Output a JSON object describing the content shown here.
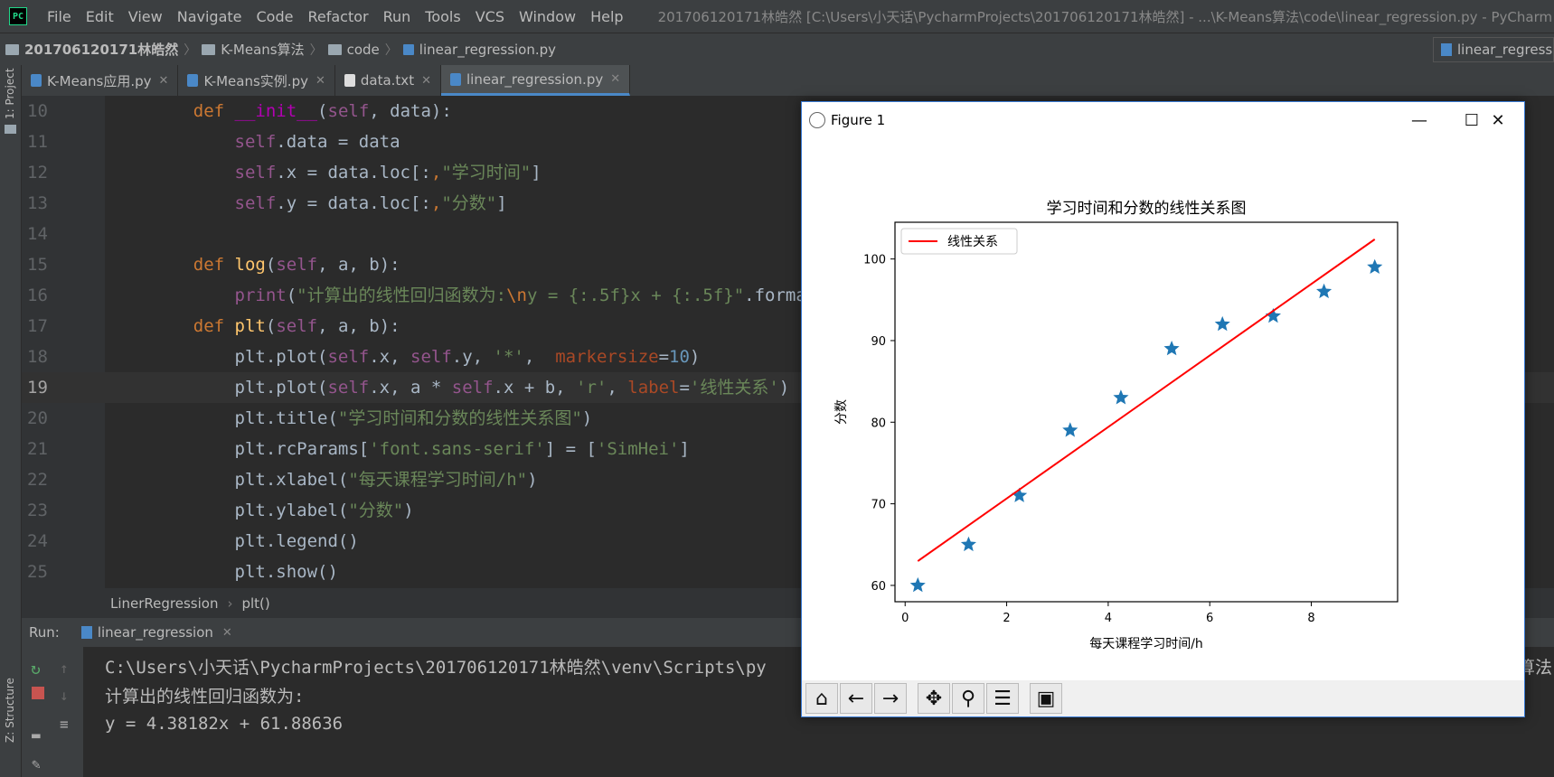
{
  "menubar": {
    "app_icon": "PC",
    "items": [
      "File",
      "Edit",
      "View",
      "Navigate",
      "Code",
      "Refactor",
      "Run",
      "Tools",
      "VCS",
      "Window",
      "Help"
    ],
    "window_title": "201706120171林皓然 [C:\\Users\\小天话\\PycharmProjects\\201706120171林皓然] - ...\\K-Means算法\\code\\linear_regression.py - PyCharm"
  },
  "breadcrumbs": [
    "201706120171林皓然",
    "K-Means算法",
    "code",
    "linear_regression.py"
  ],
  "run_config": "linear_regress",
  "left_tool": {
    "project": "1: Project",
    "structure": "Z: Structure"
  },
  "tabs": [
    {
      "label": "K-Means应用.py",
      "active": false
    },
    {
      "label": "K-Means实例.py",
      "active": false
    },
    {
      "label": "data.txt",
      "active": false
    },
    {
      "label": "linear_regression.py",
      "active": true
    }
  ],
  "editor": {
    "line_numbers": [
      "10",
      "11",
      "12",
      "13",
      "14",
      "15",
      "16",
      "17",
      "18",
      "19",
      "20",
      "21",
      "22",
      "23",
      "24",
      "25"
    ],
    "current_line": "19"
  },
  "status_crumbs": [
    "LinerRegression",
    "plt()"
  ],
  "run": {
    "label": "Run:",
    "tab": "linear_regression",
    "output": [
      "C:\\Users\\小天话\\PycharmProjects\\201706120171林皓然\\venv\\Scripts\\py",
      "计算出的线性回归函数为:",
      "y = 4.38182x + 61.88636"
    ],
    "overflow_text": "算法"
  },
  "figure": {
    "title": "Figure 1",
    "controls": {
      "minimize": "—",
      "maximize": "☐",
      "close": "✕"
    }
  },
  "chart_data": {
    "type": "scatter",
    "title": "学习时间和分数的线性关系图",
    "xlabel": "每天课程学习时间/h",
    "ylabel": "分数",
    "xlim": [
      -0.2,
      9.7
    ],
    "ylim": [
      58,
      104.5
    ],
    "xticks": [
      0,
      2,
      4,
      6,
      8
    ],
    "yticks": [
      60,
      70,
      80,
      90,
      100
    ],
    "series": [
      {
        "kind": "scatter",
        "marker": "star",
        "color": "#1f77b4",
        "x": [
          0.25,
          1.25,
          2.25,
          3.25,
          4.25,
          5.25,
          6.25,
          7.25,
          8.25,
          9.25
        ],
        "y": [
          60,
          65,
          71,
          79,
          83,
          89,
          92,
          93,
          96,
          99
        ]
      },
      {
        "kind": "line",
        "name": "线性关系",
        "color": "#ff0000",
        "x": [
          0.25,
          9.25
        ],
        "y": [
          62.98,
          102.41
        ]
      }
    ],
    "legend": "top-left"
  }
}
